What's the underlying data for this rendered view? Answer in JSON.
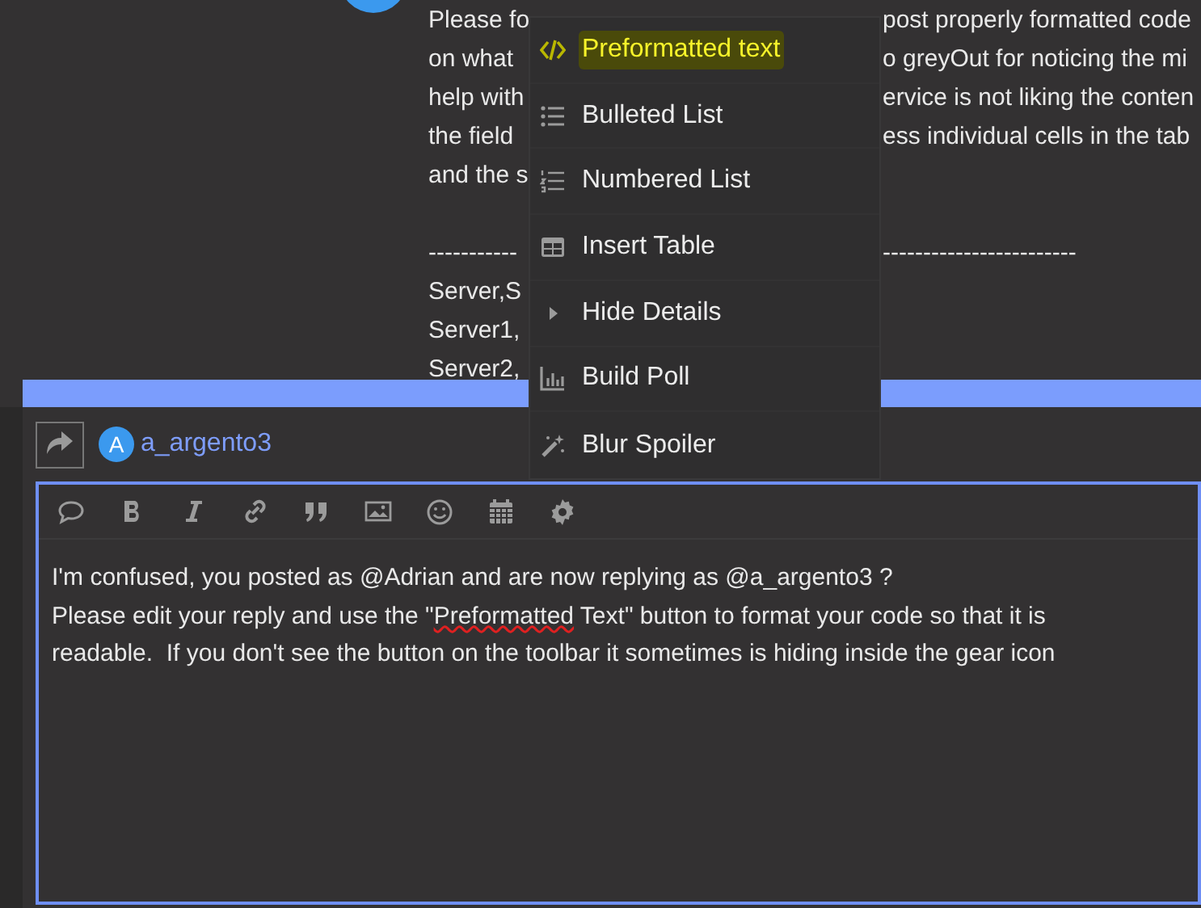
{
  "background_post": {
    "paragraphs": [
      [
        {
          "left": "Please fo",
          "right": "post properly formatted code"
        },
        {
          "left": "on what",
          "right": "o greyOut for noticing the mi"
        },
        {
          "left": "help with",
          "right": "ervice is not liking the conten"
        },
        {
          "left": "the field",
          "right": "ess individual cells in the tab"
        },
        {
          "left": "and the s"
        }
      ],
      [
        {
          "left": "-----------",
          "right": "------------------------"
        },
        {
          "left": "Server,S"
        },
        {
          "left": "Server1,"
        },
        {
          "left": "Server2,"
        }
      ]
    ]
  },
  "menu": {
    "items": [
      {
        "kind": "code",
        "label": "Preformatted text",
        "highlighted": true
      },
      {
        "kind": "bullets",
        "label": "Bulleted List",
        "highlighted": false
      },
      {
        "kind": "numbers",
        "label": "Numbered List",
        "highlighted": false
      },
      {
        "kind": "table",
        "label": "Insert Table",
        "highlighted": false
      },
      {
        "kind": "details",
        "label": "Hide Details",
        "highlighted": false
      },
      {
        "kind": "poll",
        "label": "Build Poll",
        "highlighted": false
      },
      {
        "kind": "wand",
        "label": "Blur Spoiler",
        "highlighted": false
      }
    ]
  },
  "composer": {
    "avatar_letter": "A",
    "username": "a_argento3",
    "paragraphs": [
      [
        {
          "text": "I'm confused, you posted as @Adrian and are now replying as @a_argento3 ?",
          "misspelled": false
        }
      ],
      [
        {
          "text": "Please edit your reply and use the \"",
          "misspelled": false
        },
        {
          "text": "Preformatted",
          "misspelled": true
        },
        {
          "text": " Text\" button to format your code so that it is readable.  If you don't see the button on the toolbar it sometimes is hiding inside the gear icon",
          "misspelled": false
        }
      ]
    ]
  }
}
